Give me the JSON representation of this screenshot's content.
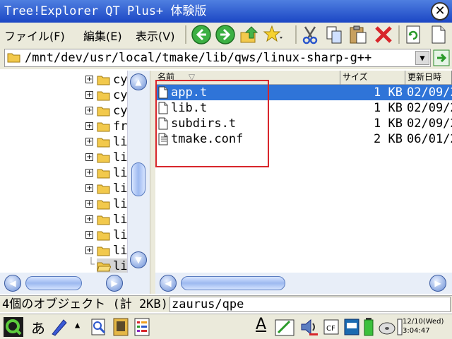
{
  "window": {
    "title": "Tree!Explorer QT Plus+ 体験版",
    "close_icon": "close-icon"
  },
  "menu": {
    "file": "ファイル(F)",
    "edit": "編集(E)",
    "view": "表示(V)"
  },
  "toolbar": {
    "icons": [
      "back-icon",
      "forward-icon",
      "up-folder-icon",
      "bookmark-star-icon",
      "cut-icon",
      "copy-icon",
      "paste-icon",
      "delete-icon",
      "refresh-icon",
      "new-file-icon"
    ]
  },
  "address": {
    "path": "/mnt/dev/usr/local/tmake/lib/qws/linux-sharp-g++"
  },
  "tree": {
    "items": [
      {
        "label": "cy"
      },
      {
        "label": "cy"
      },
      {
        "label": "cy"
      },
      {
        "label": "fr"
      },
      {
        "label": "li"
      },
      {
        "label": "li"
      },
      {
        "label": "li"
      },
      {
        "label": "li"
      },
      {
        "label": "li"
      },
      {
        "label": "li"
      },
      {
        "label": "li"
      },
      {
        "label": "li"
      }
    ],
    "selected_label": "li"
  },
  "list": {
    "columns": {
      "name": "名前",
      "size": "サイズ",
      "date": "更新日時"
    },
    "files": [
      {
        "name": "app.t",
        "size": "1 KB",
        "date": "02/09/2",
        "selected": true
      },
      {
        "name": "lib.t",
        "size": "1 KB",
        "date": "02/09/2",
        "selected": false
      },
      {
        "name": "subdirs.t",
        "size": "1 KB",
        "date": "02/09/2",
        "selected": false
      },
      {
        "name": "tmake.conf",
        "size": "2 KB",
        "date": "06/01/2",
        "selected": false
      }
    ]
  },
  "status": {
    "text": "4個のオブジェクト (計 2KB)",
    "path": "zaurus/qpe"
  },
  "taskbar": {
    "input_mode": "あ",
    "clock_date": "12/10(Wed)",
    "clock_time": "3:04:47",
    "underline_a": "A"
  },
  "colors": {
    "title_bar": "#2a56cc",
    "selection": "#2f74d8",
    "highlight_box": "#d8262b"
  }
}
